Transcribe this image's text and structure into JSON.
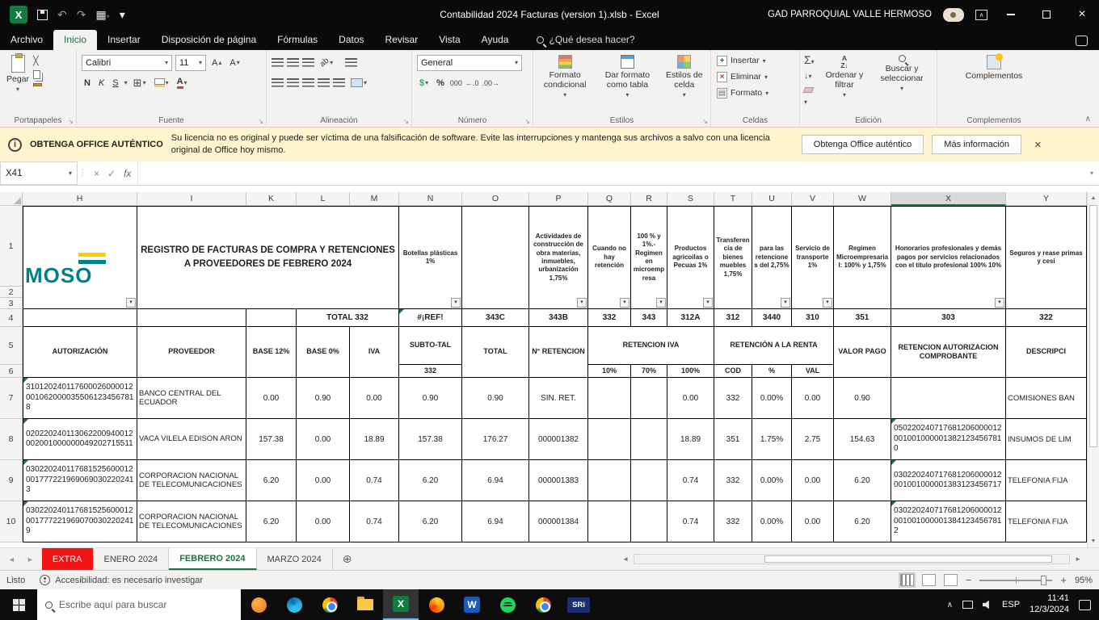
{
  "titlebar": {
    "title": "Contabilidad 2024 Facturas (version 1).xlsb - Excel",
    "account": "GAD PARROQUIAL VALLE HERMOSO"
  },
  "tabs": [
    "Archivo",
    "Inicio",
    "Insertar",
    "Disposición de página",
    "Fórmulas",
    "Datos",
    "Revisar",
    "Vista",
    "Ayuda"
  ],
  "search_label": "¿Qué desea hacer?",
  "ribbon": {
    "paste_label": "Pegar",
    "font_name": "Calibri",
    "font_size": "11",
    "bold": "N",
    "italic": "K",
    "underline": "S",
    "number_format": "General",
    "percent": "%",
    "thousands": "000",
    "dec_inc": "←.0",
    "dec_dec": ".00→",
    "cond_format": "Formato condicional",
    "format_table": "Dar formato como tabla",
    "cell_styles": "Estilos de celda",
    "insert": "Insertar",
    "delete": "Eliminar",
    "format": "Formato",
    "sort_filter": "Ordenar y filtrar",
    "find_select": "Buscar y seleccionar",
    "addins_label": "Complementos",
    "groups": {
      "clipboard": "Portapapeles",
      "font": "Fuente",
      "alignment": "Alineación",
      "number": "Número",
      "styles": "Estilos",
      "cells": "Celdas",
      "editing": "Edición",
      "addins": "Complementos"
    }
  },
  "warning": {
    "title": "OBTENGA OFFICE AUTÉNTICO",
    "message": "Su licencia no es original y puede ser víctima de una falsificación de software. Evite las interrupciones y mantenga sus archivos a salvo con una licencia original de Office hoy mismo.",
    "button1": "Obtenga Office auténtico",
    "button2": "Más información"
  },
  "formula_bar": {
    "name_box": "X41",
    "fx": "fx",
    "value": ""
  },
  "grid": {
    "col_letters": [
      "H",
      "I",
      "K",
      "L",
      "M",
      "N",
      "O",
      "P",
      "Q",
      "R",
      "S",
      "T",
      "U",
      "V",
      "W",
      "X",
      "Y"
    ],
    "row_numbers": [
      "1",
      "2",
      "3",
      "4",
      "5",
      "6"
    ],
    "logo_text": "MOSO",
    "title": "REGISTRO DE FACTURAS DE COMPRA Y RETENCIONES A PROVEEDORES DE FEBRERO 2024",
    "cat": {
      "botellas": "Botellas plásticas 1%",
      "construccion": "Actividades de construcción de obra materias, inmuebles, urbanización 1,75%",
      "sin_ret": "Cuando no hay retención",
      "microempresa": "100 % y 1%.- Regimen en microempresa",
      "agricolas": "Productos agricoilas o Pecuas 1%",
      "bienes": "Transferencia de bienes muebles 1,75%",
      "ret275": "para las retenciones del 2,75%",
      "transporte": "Servicio de transporte 1%",
      "regimen": "Regimen Microempresarial: 100% y 1,75%",
      "honorarios": "Honorarios profesionales y demás pagos por servicios relacionados con el título profesional 100% 10%",
      "seguros": "Seguros y rease primas y cesi"
    },
    "codes": {
      "lm": "TOTAL 332",
      "n": "#¡REF!",
      "o": "343C",
      "p": "343B",
      "q": "332",
      "r": "343",
      "s": "312A",
      "t": "312",
      "u": "3440",
      "v": "310",
      "w": "351",
      "x": "303",
      "y": "322"
    },
    "head": {
      "autorizacion": "AUTORIZACIÓN",
      "proveedor": "PROVEEDOR",
      "base12": "BASE 12%",
      "base0": "BASE 0%",
      "iva": "IVA",
      "subtotal": "SUBTO-TAL",
      "subtotal2": "332",
      "total": "TOTAL",
      "nret": "N° RETENCION",
      "ret_iva": "RETENCION IVA",
      "p10": "10%",
      "p70": "70%",
      "p100": "100%",
      "ret_renta": "RETENCIÓN A LA RENTA",
      "cod": "COD",
      "pct": "%",
      "val": "VAL",
      "pago": "VALOR PAGO",
      "ret_aut": "RETENCION AUTORIZACION COMPROBANTE",
      "desc": "DESCRIPCI"
    },
    "rows": [
      {
        "num": "7",
        "aut": "3101202401176000260000120010620000355061234567818",
        "prov": "BANCO CENTRAL DEL ECUADOR",
        "b12": "0.00",
        "b0": "0.90",
        "iva": "0.00",
        "sub": "0.90",
        "tot": "0.90",
        "nret": "SIN. RET.",
        "r100": "0.00",
        "cod": "332",
        "pct": "0.00%",
        "val": "0.00",
        "pago": "0.90",
        "retaut": "",
        "desc": "COMISIONES BAN"
      },
      {
        "num": "8",
        "aut": "020220240113062200940012002001000000049202715511",
        "prov": "VACA VILELA EDISON ARON",
        "b12": "157.38",
        "b0": "0.00",
        "iva": "18.89",
        "sub": "157.38",
        "tot": "176.27",
        "nret": "000001382",
        "r100": "18.89",
        "cod": "351",
        "pct": "1.75%",
        "val": "2.75",
        "pago": "154.63",
        "retaut": "0502202407176812060000120010010000013821234567810",
        "desc": "INSUMOS DE LIM"
      },
      {
        "num": "9",
        "aut": "0302202401176815256000120017772219690690302202413",
        "prov": "CORPORACION NACIONAL DE TELECOMUNICACIONES",
        "b12": "6.20",
        "b0": "0.00",
        "iva": "0.74",
        "sub": "6.20",
        "tot": "6.94",
        "nret": "000001383",
        "r100": "0.74",
        "cod": "332",
        "pct": "0.00%",
        "val": "0.00",
        "pago": "6.20",
        "retaut": "030220240717681206000012001001000001383123456717",
        "desc": "TELEFONIA FIJA"
      },
      {
        "num": "10",
        "aut": "0302202401176815256000120017772219690700302202419",
        "prov": "CORPORACION NACIONAL DE TELECOMUNICACIONES",
        "b12": "6.20",
        "b0": "0.00",
        "iva": "0.74",
        "sub": "6.20",
        "tot": "6.94",
        "nret": "000001384",
        "r100": "0.74",
        "cod": "332",
        "pct": "0.00%",
        "val": "0.00",
        "pago": "6.20",
        "retaut": "0302202407176812060000120010010000013841234567812",
        "desc": "TELEFONIA FIJA"
      }
    ]
  },
  "sheets": {
    "tabs": [
      "EXTRA",
      "ENERO 2024",
      "FEBRERO 2024",
      "MARZO 2024"
    ]
  },
  "status": {
    "ready": "Listo",
    "accessibility": "Accesibilidad: es necesario investigar",
    "zoom": "95%"
  },
  "taskbar": {
    "search_placeholder": "Escribe aquí para buscar",
    "sri": "SRi",
    "lang": "ESP",
    "time": "11:41",
    "date": "12/3/2024"
  }
}
